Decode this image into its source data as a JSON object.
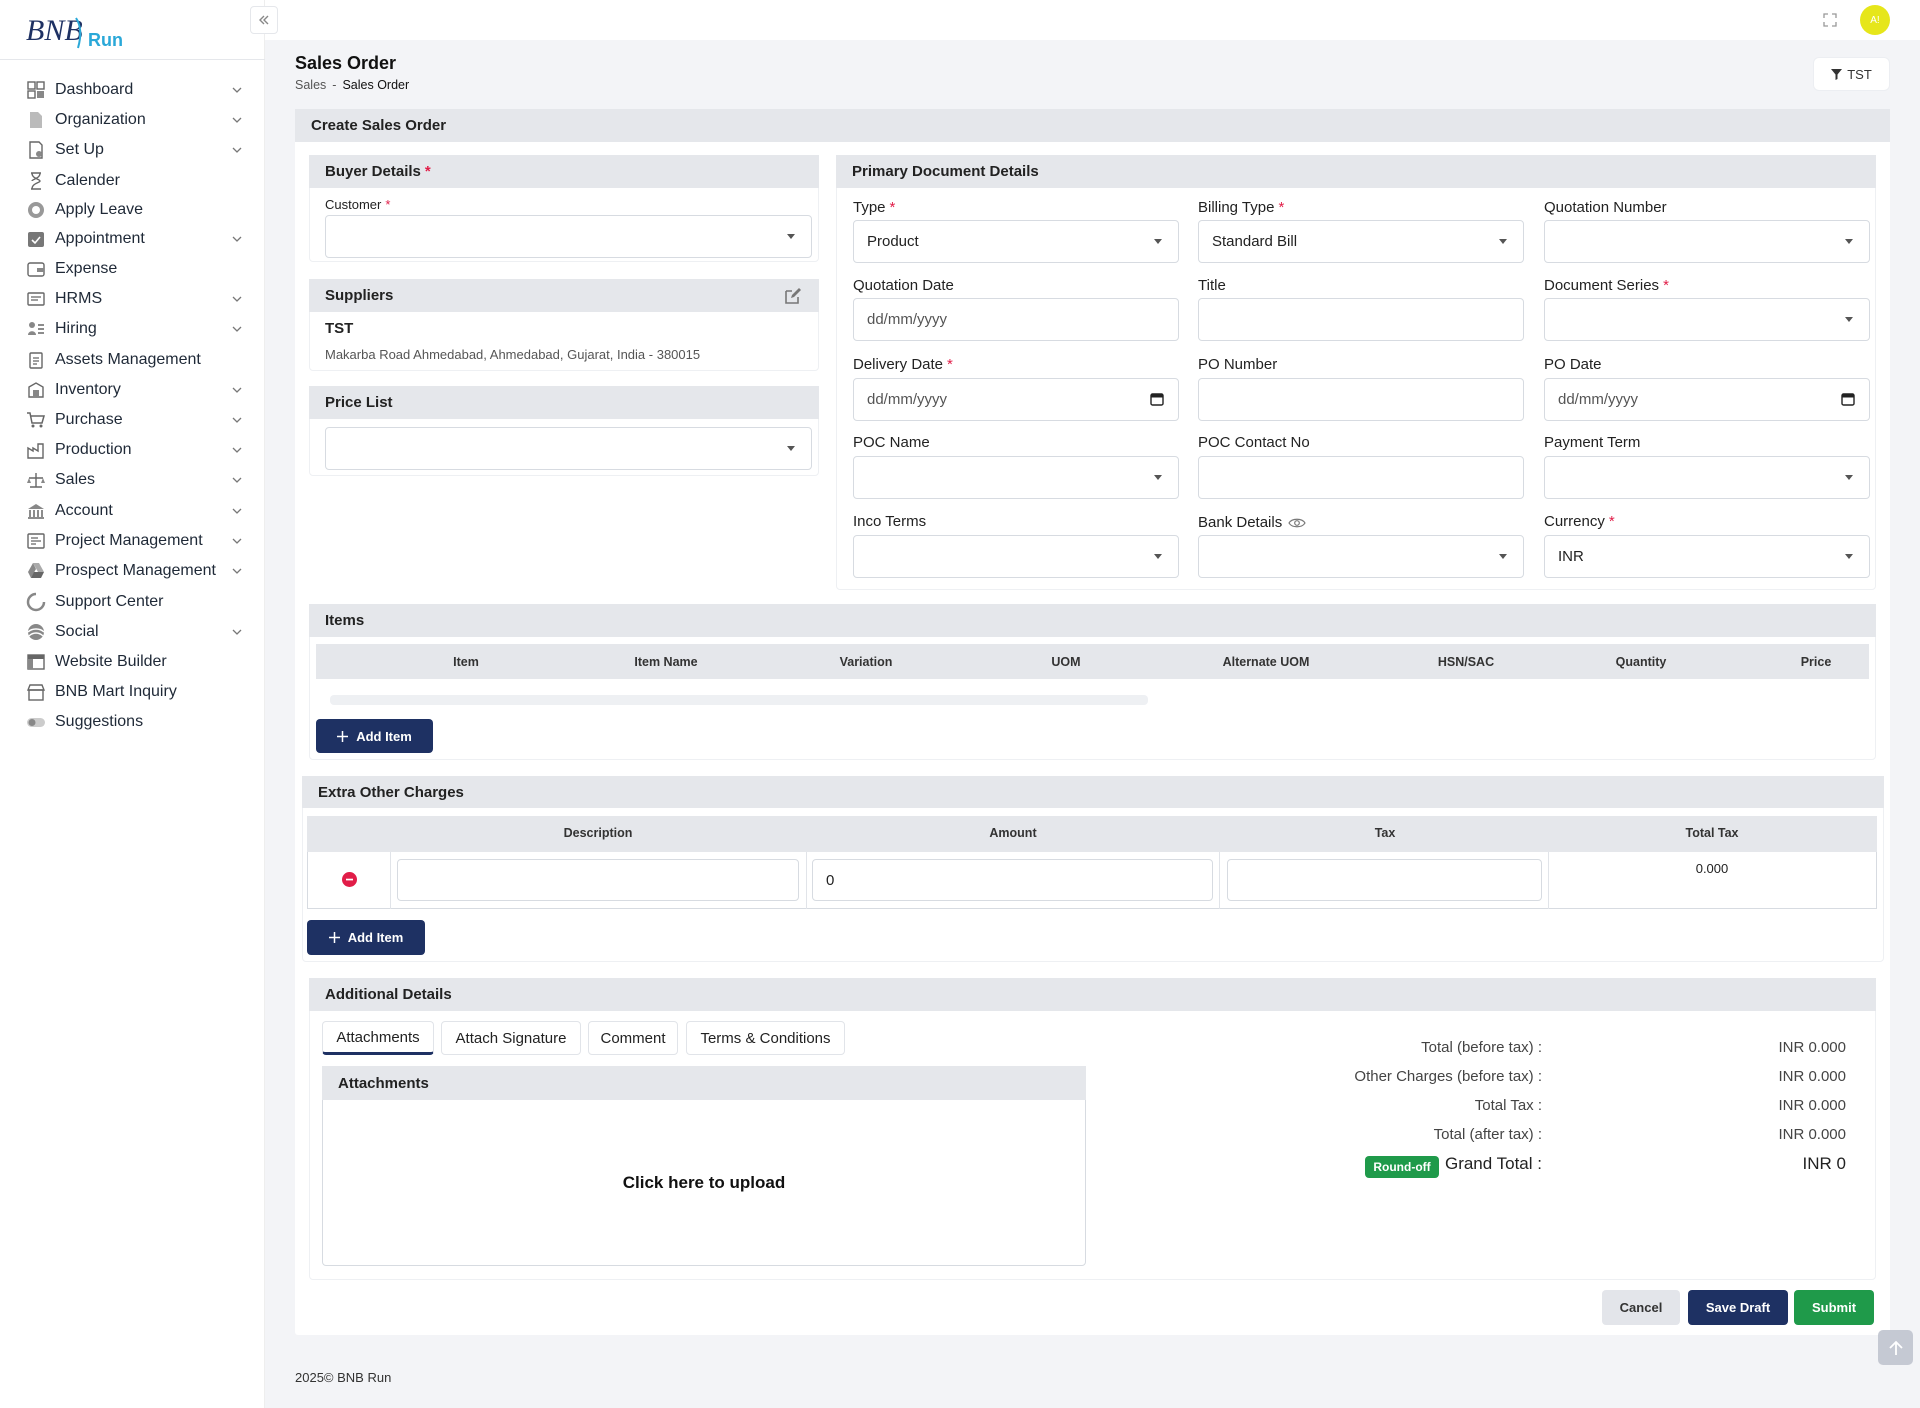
{
  "brand": {
    "name_part1": "BNB",
    "name_part2": "Run"
  },
  "sidebar": {
    "items": [
      {
        "label": "Dashboard",
        "icon": "dashboard-icon",
        "expandable": true
      },
      {
        "label": "Organization",
        "icon": "document-icon",
        "expandable": true
      },
      {
        "label": "Set Up",
        "icon": "settings-document-icon",
        "expandable": true
      },
      {
        "label": "Calender",
        "icon": "hourglass-icon",
        "expandable": false
      },
      {
        "label": "Apply Leave",
        "icon": "lifebuoy-icon",
        "expandable": false
      },
      {
        "label": "Appointment",
        "icon": "calendar-check-icon",
        "expandable": true
      },
      {
        "label": "Expense",
        "icon": "wallet-icon",
        "expandable": false
      },
      {
        "label": "HRMS",
        "icon": "id-card-icon",
        "expandable": true
      },
      {
        "label": "Hiring",
        "icon": "person-list-icon",
        "expandable": true
      },
      {
        "label": "Assets Management",
        "icon": "clipboard-icon",
        "expandable": false
      },
      {
        "label": "Inventory",
        "icon": "inventory-icon",
        "expandable": true
      },
      {
        "label": "Purchase",
        "icon": "cart-icon",
        "expandable": true
      },
      {
        "label": "Production",
        "icon": "factory-icon",
        "expandable": true
      },
      {
        "label": "Sales",
        "icon": "scale-icon",
        "expandable": true
      },
      {
        "label": "Account",
        "icon": "bank-icon",
        "expandable": true
      },
      {
        "label": "Project Management",
        "icon": "project-icon",
        "expandable": true
      },
      {
        "label": "Prospect Management",
        "icon": "drive-icon",
        "expandable": true
      },
      {
        "label": "Support Center",
        "icon": "support-icon",
        "expandable": false
      },
      {
        "label": "Social",
        "icon": "social-icon",
        "expandable": true
      },
      {
        "label": "Website Builder",
        "icon": "layout-icon",
        "expandable": false
      },
      {
        "label": "BNB Mart Inquiry",
        "icon": "store-icon",
        "expandable": false
      },
      {
        "label": "Suggestions",
        "icon": "toggle-icon",
        "expandable": false
      }
    ]
  },
  "topbar": {
    "avatar_initials": "A!"
  },
  "page": {
    "title": "Sales Order",
    "breadcrumb": {
      "parent": "Sales",
      "sep": "-",
      "current": "Sales Order"
    },
    "filter_label": "TST"
  },
  "form": {
    "card_title": "Create Sales Order",
    "buyer": {
      "title": "Buyer Details",
      "customer_label": "Customer",
      "customer_value": ""
    },
    "suppliers": {
      "title": "Suppliers",
      "name": "TST",
      "address": "Makarba Road Ahmedabad, Ahmedabad, Gujarat, India - 380015"
    },
    "price_list": {
      "title": "Price List",
      "value": ""
    },
    "primary": {
      "title": "Primary Document Details",
      "type_label": "Type",
      "type_value": "Product",
      "billing_type_label": "Billing Type",
      "billing_type_value": "Standard Bill",
      "quotation_number_label": "Quotation Number",
      "quotation_date_label": "Quotation Date",
      "quotation_date_placeholder": "dd/mm/yyyy",
      "title_label": "Title",
      "document_series_label": "Document Series",
      "delivery_date_label": "Delivery Date",
      "delivery_date_placeholder": "dd/mm/yyyy",
      "po_number_label": "PO Number",
      "po_date_label": "PO Date",
      "po_date_placeholder": "dd/mm/yyyy",
      "poc_name_label": "POC Name",
      "poc_contact_label": "POC Contact No",
      "payment_term_label": "Payment Term",
      "inco_terms_label": "Inco Terms",
      "bank_details_label": "Bank Details",
      "currency_label": "Currency",
      "currency_value": "INR"
    },
    "items": {
      "title": "Items",
      "columns": [
        "Item",
        "Item Name",
        "Variation",
        "UOM",
        "Alternate UOM",
        "HSN/SAC",
        "Quantity",
        "Price"
      ],
      "add_label": "Add Item"
    },
    "extra": {
      "title": "Extra Other Charges",
      "columns": [
        "Description",
        "Amount",
        "Tax",
        "Total Tax"
      ],
      "row": {
        "description": "",
        "amount": "0",
        "tax": "",
        "total_tax": "0.000"
      },
      "add_label": "Add Item"
    },
    "additional": {
      "title": "Additional Details",
      "tabs": [
        "Attachments",
        "Attach Signature",
        "Comment",
        "Terms & Conditions"
      ],
      "active_tab": "Attachments",
      "attachments_title": "Attachments",
      "upload_text": "Click here to upload"
    },
    "totals": {
      "before_tax_label": "Total (before tax) :",
      "before_tax_value": "INR 0.000",
      "other_label": "Other Charges (before tax) :",
      "other_value": "INR 0.000",
      "tax_label": "Total Tax :",
      "tax_value": "INR 0.000",
      "after_tax_label": "Total (after tax) :",
      "after_tax_value": "INR 0.000",
      "roundoff_badge": "Round-off",
      "grand_label": "Grand Total :",
      "grand_value": "INR 0"
    },
    "actions": {
      "cancel": "Cancel",
      "save_draft": "Save Draft",
      "submit": "Submit"
    }
  },
  "footer": {
    "text": "2025© BNB Run"
  },
  "colors": {
    "primary": "#1e3163",
    "success": "#1f9a4a",
    "danger": "#e11d48",
    "accent": "#2aa8d8"
  }
}
